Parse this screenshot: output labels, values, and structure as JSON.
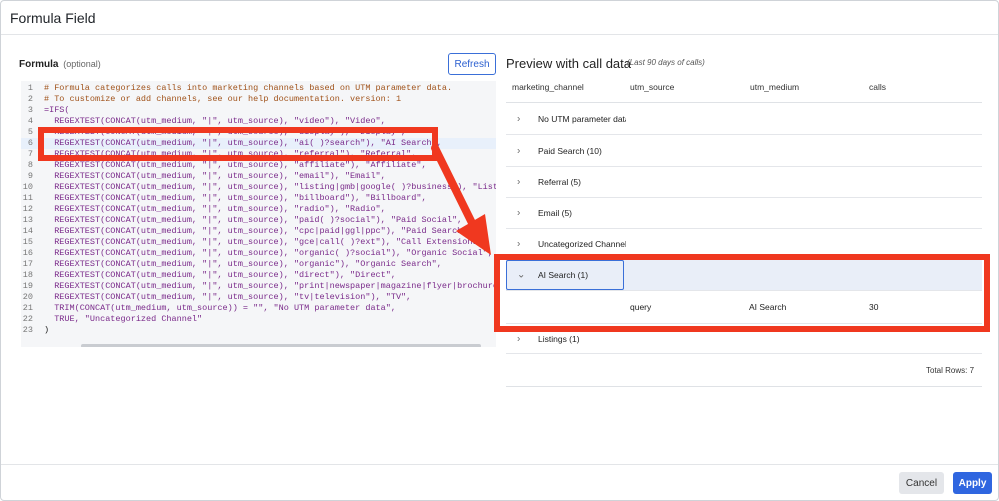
{
  "modal": {
    "title": "Formula Field"
  },
  "formula": {
    "label": "Formula",
    "optional_label": "(optional)",
    "refresh_label": "Refresh",
    "active_line": 6,
    "lines": [
      {
        "num": "1",
        "code": "# Formula categorizes calls into marketing channels based on UTM parameter data.",
        "kind": "comment"
      },
      {
        "num": "2",
        "code": "# To customize or add channels, see our help documentation. version: 1",
        "kind": "comment"
      },
      {
        "num": "3",
        "code": "=IFS(",
        "kind": "code"
      },
      {
        "num": "4",
        "code": "  REGEXTEST(CONCAT(utm_medium, \"|\", utm_source), \"video\"), \"Video\",",
        "kind": "code"
      },
      {
        "num": "5",
        "code": "  REGEXTEST(CONCAT(utm_medium, \"|\", utm_source), \"display\"), \"Display\",",
        "kind": "code"
      },
      {
        "num": "6",
        "code": "  REGEXTEST(CONCAT(utm_medium, \"|\", utm_source), \"ai( )?search\"), \"AI Search\",",
        "kind": "code"
      },
      {
        "num": "7",
        "code": "  REGEXTEST(CONCAT(utm_medium, \"|\", utm_source), \"referral\"), \"Referral\",",
        "kind": "code"
      },
      {
        "num": "8",
        "code": "  REGEXTEST(CONCAT(utm_medium, \"|\", utm_source), \"affiliate\"), \"Affiliate\",",
        "kind": "code"
      },
      {
        "num": "9",
        "code": "  REGEXTEST(CONCAT(utm_medium, \"|\", utm_source), \"email\"), \"Email\",",
        "kind": "code"
      },
      {
        "num": "10",
        "code": "  REGEXTEST(CONCAT(utm_medium, \"|\", utm_source), \"listing|gmb|google( )?business\"), \"Listings\"",
        "kind": "code"
      },
      {
        "num": "11",
        "code": "  REGEXTEST(CONCAT(utm_medium, \"|\", utm_source), \"billboard\"), \"Billboard\",",
        "kind": "code"
      },
      {
        "num": "12",
        "code": "  REGEXTEST(CONCAT(utm_medium, \"|\", utm_source), \"radio\"), \"Radio\",",
        "kind": "code"
      },
      {
        "num": "13",
        "code": "  REGEXTEST(CONCAT(utm_medium, \"|\", utm_source), \"paid( )?social\"), \"Paid Social\",",
        "kind": "code"
      },
      {
        "num": "14",
        "code": "  REGEXTEST(CONCAT(utm_medium, \"|\", utm_source), \"cpc|paid|ggl|ppc\"), \"Paid Search\",",
        "kind": "code"
      },
      {
        "num": "15",
        "code": "  REGEXTEST(CONCAT(utm_medium, \"|\", utm_source), \"gce|call( )?ext\"), \"Call Extensions\",",
        "kind": "code"
      },
      {
        "num": "16",
        "code": "  REGEXTEST(CONCAT(utm_medium, \"|\", utm_source), \"organic( )?social\"), \"Organic Social\",",
        "kind": "code"
      },
      {
        "num": "17",
        "code": "  REGEXTEST(CONCAT(utm_medium, \"|\", utm_source), \"organic\"), \"Organic Search\",",
        "kind": "code"
      },
      {
        "num": "18",
        "code": "  REGEXTEST(CONCAT(utm_medium, \"|\", utm_source), \"direct\"), \"Direct\",",
        "kind": "code"
      },
      {
        "num": "19",
        "code": "  REGEXTEST(CONCAT(utm_medium, \"|\", utm_source), \"print|newspaper|magazine|flyer|brochure\"), \"",
        "kind": "code"
      },
      {
        "num": "20",
        "code": "  REGEXTEST(CONCAT(utm_medium, \"|\", utm_source), \"tv|television\"), \"TV\",",
        "kind": "code"
      },
      {
        "num": "21",
        "code": "  TRIM(CONCAT(utm_medium, utm_source)) = \"\", \"No UTM parameter data\",",
        "kind": "code"
      },
      {
        "num": "22",
        "code": "  TRUE, \"Uncategorized Channel\"",
        "kind": "code"
      },
      {
        "num": "23",
        "code": ")",
        "kind": "plain"
      }
    ]
  },
  "preview": {
    "title": "Preview with call data",
    "subtitle": "(Last 90 days of calls)",
    "columns": [
      "marketing_channel",
      "utm_source",
      "utm_medium",
      "calls"
    ],
    "rows": [
      {
        "label": "No UTM parameter data",
        "expanded": false
      },
      {
        "label": "Paid Search (10)",
        "expanded": false
      },
      {
        "label": "Referral (5)",
        "expanded": false
      },
      {
        "label": "Email (5)",
        "expanded": false
      },
      {
        "label": "Uncategorized Channel (",
        "expanded": false
      },
      {
        "label": "AI Search (1)",
        "expanded": true
      },
      {
        "label": "Listings (1)",
        "expanded": false
      }
    ],
    "detail_row": {
      "utm_source": "query",
      "utm_medium": "AI Search",
      "calls": "30"
    },
    "total_rows": "Total Rows: 7"
  },
  "footer": {
    "cancel_label": "Cancel",
    "apply_label": "Apply"
  },
  "colors": {
    "annotation": "#f0381f",
    "accent": "#2f66e0"
  },
  "icons": {
    "collapsed_row": "chevron-right-icon",
    "expanded_row": "chevron-down-icon"
  }
}
